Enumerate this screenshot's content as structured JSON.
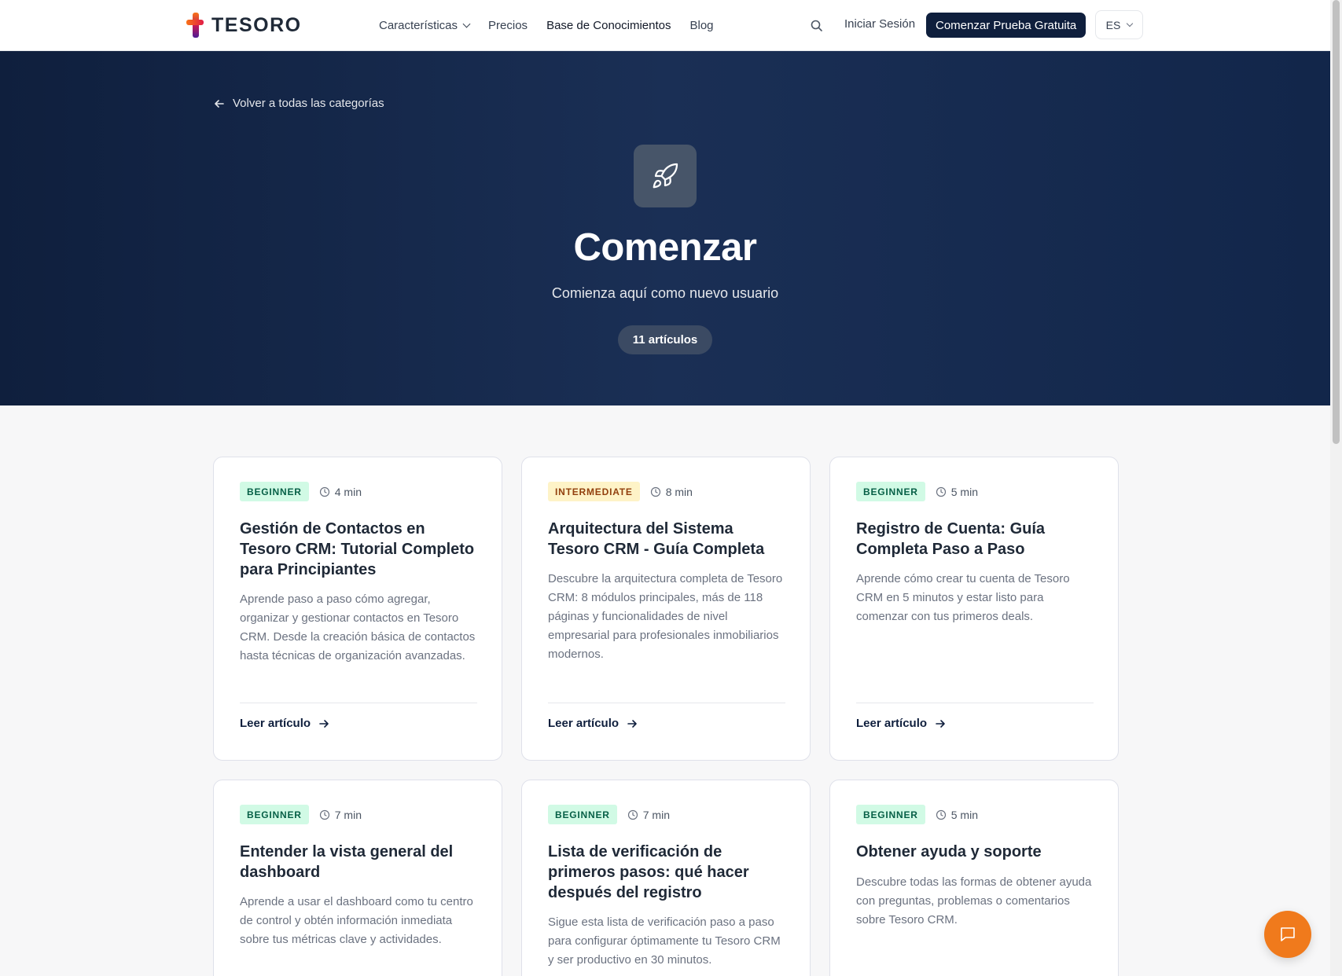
{
  "header": {
    "logo_text": "TESORO",
    "nav": [
      {
        "label": "Características"
      },
      {
        "label": "Precios"
      },
      {
        "label": "Base de Conocimientos"
      },
      {
        "label": "Blog"
      }
    ],
    "login_label": "Iniciar Sesión",
    "cta_label": "Comenzar Prueba Gratuita",
    "language": "ES"
  },
  "hero": {
    "back_label": "Volver a todas las categorías",
    "icon": "rocket-icon",
    "title": "Comenzar",
    "subtitle": "Comienza aquí como nuevo usuario",
    "count": "11 artículos"
  },
  "articles": [
    {
      "level": "BEGINNER",
      "time": "4 min",
      "title": "Gestión de Contactos en Tesoro CRM: Tutorial Completo para Principiantes",
      "description": "Aprende paso a paso cómo agregar, organizar y gestionar contactos en Tesoro CRM. Desde la creación básica de contactos hasta técnicas de organización avanzadas.",
      "link": "Leer artículo"
    },
    {
      "level": "INTERMEDIATE",
      "time": "8 min",
      "title": "Arquitectura del Sistema Tesoro CRM - Guía Completa",
      "description": "Descubre la arquitectura completa de Tesoro CRM: 8 módulos principales, más de 118 páginas y funcionalidades de nivel empresarial para profesionales inmobiliarios modernos.",
      "link": "Leer artículo"
    },
    {
      "level": "BEGINNER",
      "time": "5 min",
      "title": "Registro de Cuenta: Guía Completa Paso a Paso",
      "description": "Aprende cómo crear tu cuenta de Tesoro CRM en 5 minutos y estar listo para comenzar con tus primeros deals.",
      "link": "Leer artículo"
    },
    {
      "level": "BEGINNER",
      "time": "7 min",
      "title": "Entender la vista general del dashboard",
      "description": "Aprende a usar el dashboard como tu centro de control y obtén información inmediata sobre tus métricas clave y actividades."
    },
    {
      "level": "BEGINNER",
      "time": "7 min",
      "title": "Lista de verificación de primeros pasos: qué hacer después del registro",
      "description": "Sigue esta lista de verificación paso a paso para configurar óptimamente tu Tesoro CRM y ser productivo en 30 minutos."
    },
    {
      "level": "BEGINNER",
      "time": "5 min",
      "title": "Obtener ayuda y soporte",
      "description": "Descubre todas las formas de obtener ayuda con preguntas, problemas o comentarios sobre Tesoro CRM."
    }
  ],
  "chat": {
    "icon": "chat-icon"
  },
  "colors": {
    "navy": "#0f1f3d",
    "accent_orange": "#f07a1c",
    "beginner_bg": "#d1fae5",
    "intermediate_bg": "#fef3c7"
  }
}
